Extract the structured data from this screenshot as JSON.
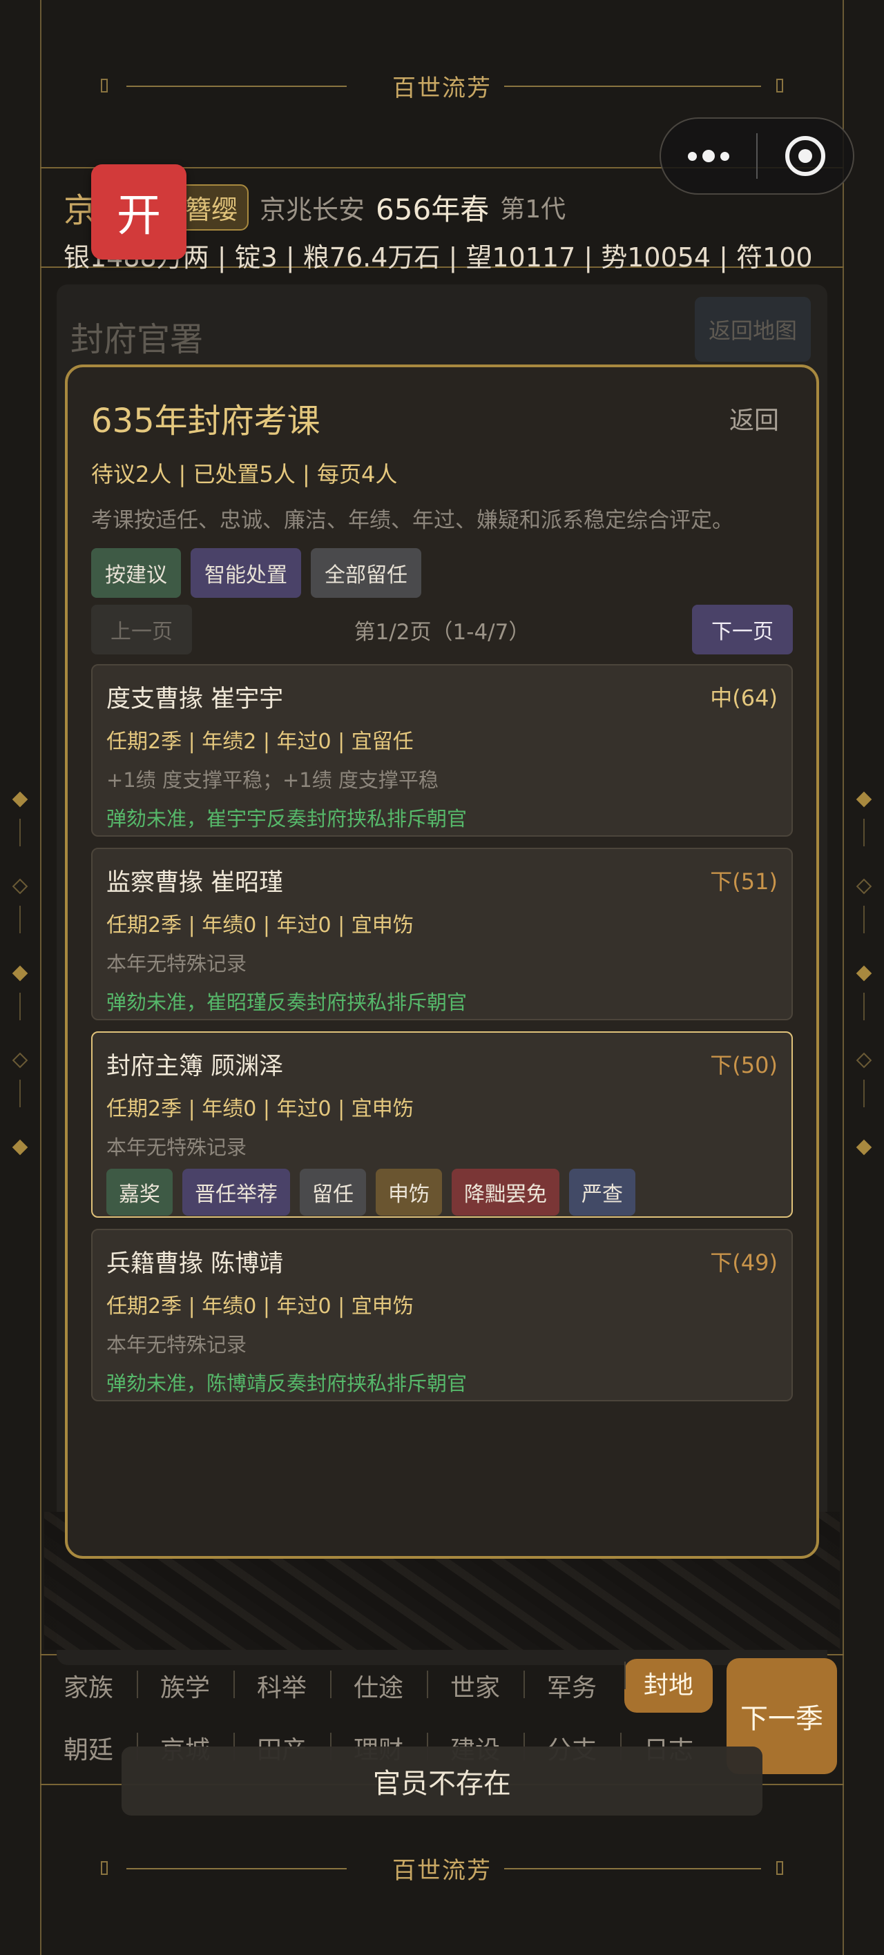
{
  "banner": {
    "title": "百世流芳"
  },
  "header": {
    "family": "京兆氏",
    "rank_tag": "簪缨",
    "location": "京兆长安",
    "year": "656年春",
    "generation": "第1代",
    "resources": "银1488万两 | 锭3 | 粮76.4万石 | 望10117 | 势10054 | 符100",
    "open_button": "开"
  },
  "background_panel": {
    "title": "封府官署",
    "back": "返回地图"
  },
  "modal": {
    "title": "635年封府考课",
    "back": "返回",
    "stats": "待议2人 | 已处置5人 | 每页4人",
    "description": "考课按适任、忠诚、廉洁、年绩、年过、嫌疑和派系稳定综合评定。",
    "actions": [
      "按建议",
      "智能处置",
      "全部留任"
    ],
    "pager": {
      "prev": "上一页",
      "info": "第1/2页（1-4/7）",
      "next": "下一页"
    },
    "cards": [
      {
        "name": "度支曹掾 崔宇宇",
        "grade": "中(64)",
        "grade_color": "#e5c87e",
        "metrics": "任期2季 | 年绩2 | 年过0 | 宜留任",
        "note": "+1绩 度支撑平稳；+1绩 度支撑平稳",
        "event": "弹劾未准，崔宇宇反奏封府挟私排斥朝官"
      },
      {
        "name": "监察曹掾 崔昭瑾",
        "grade": "下(51)",
        "grade_color": "#c9944a",
        "metrics": "任期2季 | 年绩0 | 年过0 | 宜申饬",
        "note": "本年无特殊记录",
        "event": "弹劾未准，崔昭瑾反奏封府挟私排斥朝官"
      },
      {
        "name": "封府主簿 顾渊泽",
        "grade": "下(50)",
        "grade_color": "#c9944a",
        "metrics": "任期2季 | 年绩0 | 年过0 | 宜申饬",
        "note": "本年无特殊记录",
        "ops": [
          "嘉奖",
          "晋任举荐",
          "留任",
          "申饬",
          "降黜罢免",
          "严查"
        ]
      },
      {
        "name": "兵籍曹掾 陈博靖",
        "grade": "下(49)",
        "grade_color": "#c9944a",
        "metrics": "任期2季 | 年绩0 | 年过0 | 宜申饬",
        "note": "本年无特殊记录",
        "event": "弹劾未准，陈博靖反奏封府挟私排斥朝官"
      }
    ]
  },
  "nav": {
    "row1": [
      "家族",
      "族学",
      "科举",
      "仕途",
      "世家",
      "军务",
      "封地"
    ],
    "row2": [
      "朝廷",
      "京城",
      "田产",
      "理财",
      "建设",
      "分支",
      "日志"
    ],
    "active": "封地",
    "next_season": "下一季"
  },
  "toast": "官员不存在",
  "colors": {
    "accent": "#a8893f",
    "gold_text": "#e5c87e",
    "active_nav": "#a8722e",
    "event_green": "#56b86a"
  }
}
